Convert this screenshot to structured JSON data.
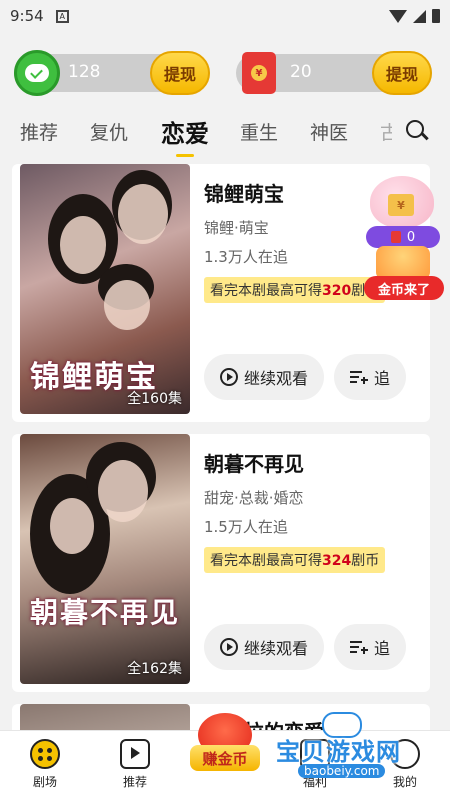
{
  "status_bar": {
    "time": "9:54",
    "app_badge": "A"
  },
  "wallet": {
    "wechat_amount": "128",
    "wechat_withdraw": "提现",
    "redpacket_amount": "20",
    "redpacket_withdraw": "提现",
    "coin_symbol": "¥"
  },
  "tabs": [
    {
      "label": "推荐"
    },
    {
      "label": "复仇"
    },
    {
      "label": "恋爱",
      "active": true
    },
    {
      "label": "重生"
    },
    {
      "label": "神医"
    },
    {
      "label": "古"
    }
  ],
  "dramas": [
    {
      "title": "锦鲤萌宝",
      "tags": "锦鲤·萌宝",
      "followers": "1.3万人在追",
      "reward_prefix": "看完本剧最高可得",
      "reward_num": "320",
      "reward_suffix": "剧币",
      "episodes": "全160集",
      "poster_title": "锦鲤萌宝",
      "watch_label": "继续观看",
      "follow_label": "追"
    },
    {
      "title": "朝暮不再见",
      "tags": "甜宠·总裁·婚恋",
      "followers": "1.5万人在追",
      "reward_prefix": "看完本剧最高可得",
      "reward_num": "324",
      "reward_suffix": "剧币",
      "episodes": "全162集",
      "poster_title": "朝暮不再见",
      "watch_label": "继续观看",
      "follow_label": "追"
    },
    {
      "title": "潘多拉的恋爱"
    }
  ],
  "floating_reward": {
    "yen": "¥",
    "count": "0",
    "label": "金币来了"
  },
  "bottom_nav": {
    "drama": "剧场",
    "recommend": "推荐",
    "earn": "赚金币",
    "welfare": "福利",
    "mine": "我的"
  },
  "watermark": {
    "brand": "宝贝游戏网",
    "url": "baobeiy.com"
  },
  "colors": {
    "accent": "#f5c200",
    "reward_bg": "#ffe98a",
    "reward_num": "#d0021b",
    "red": "#e82a2a"
  }
}
